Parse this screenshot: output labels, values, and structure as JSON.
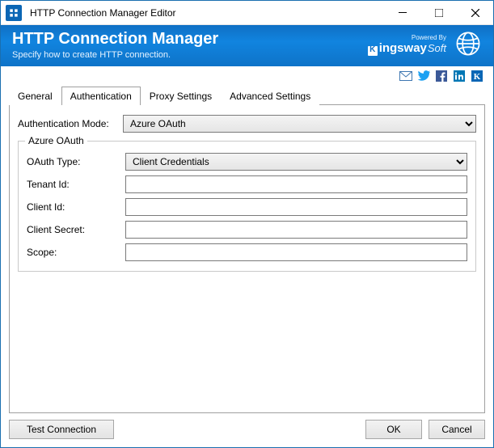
{
  "window": {
    "title": "HTTP Connection Manager Editor"
  },
  "header": {
    "title": "HTTP Connection Manager",
    "subtitle": "Specify how to create HTTP connection.",
    "powered_by": "Powered By",
    "brand_main": "ingsway",
    "brand_suffix": "Soft"
  },
  "tabs": {
    "general": "General",
    "authentication": "Authentication",
    "proxy": "Proxy Settings",
    "advanced": "Advanced Settings"
  },
  "form": {
    "auth_mode_label": "Authentication Mode:",
    "auth_mode_value": "Azure OAuth",
    "group_legend": "Azure OAuth",
    "oauth_type_label": "OAuth Type:",
    "oauth_type_value": "Client Credentials",
    "tenant_id_label": "Tenant Id:",
    "tenant_id_value": "",
    "client_id_label": "Client Id:",
    "client_id_value": "",
    "client_secret_label": "Client Secret:",
    "client_secret_value": "",
    "scope_label": "Scope:",
    "scope_value": ""
  },
  "footer": {
    "test_connection": "Test Connection",
    "ok": "OK",
    "cancel": "Cancel"
  }
}
